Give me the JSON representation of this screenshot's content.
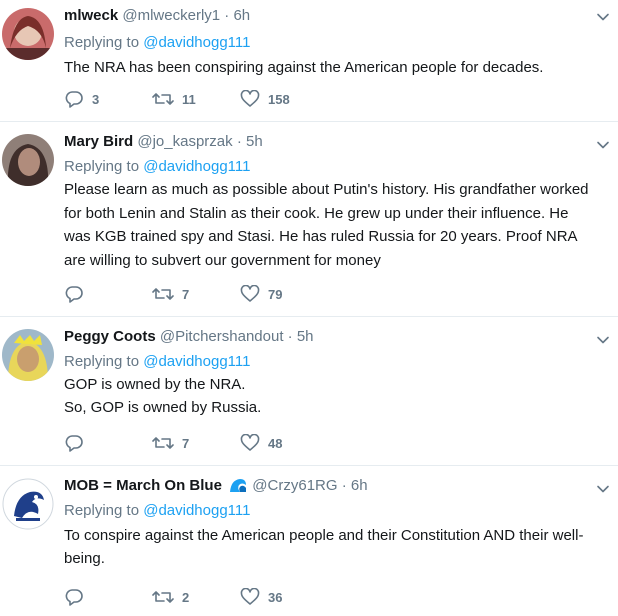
{
  "tweets": [
    {
      "name": "mlweck",
      "handle": "@mlweckerly1",
      "separator": "·",
      "time": "6h",
      "replying_prefix": "Replying to ",
      "replying_to": "@davidhogg111",
      "text": "The NRA has been conspiring against the American people for decades.",
      "replies": "3",
      "retweets": "11",
      "likes": "158",
      "avatar_colors": [
        "#7a2e2a",
        "#e7c7b5"
      ]
    },
    {
      "name": "Mary Bird",
      "handle": "@jo_kasprzak",
      "separator": "·",
      "time": "5h",
      "replying_prefix": "Replying to ",
      "replying_to": "@davidhogg111",
      "text": "Please learn as much as possible about Putin's history. His grandfather worked\nfor both Lenin and Stalin as their cook. He grew up under their influence. He\nwas KGB trained spy and Stasi. He has ruled Russia for 20 years. Proof NRA\nare willing to subvert our government for money",
      "replies": "",
      "retweets": "7",
      "likes": "79",
      "avatar_colors": [
        "#3f2e2b",
        "#b08c7c"
      ]
    },
    {
      "name": "Peggy Coots",
      "handle": "@Pitchershandout",
      "separator": "·",
      "time": "5h",
      "replying_prefix": "Replying to ",
      "replying_to": "@davidhogg111",
      "text": "GOP is owned by the NRA.\nSo, GOP is owned by Russia.",
      "replies": "",
      "retweets": "7",
      "likes": "48",
      "avatar_colors": [
        "#e8d65a",
        "#c99f6e"
      ]
    },
    {
      "name": "MOB = March On Blue",
      "handle": "@Crzy61RG",
      "separator": "·",
      "time": "6h",
      "replying_prefix": "Replying to ",
      "replying_to": "@davidhogg111",
      "text": "To conspire against the American people and their Constitution AND their well-\nbeing.",
      "replies": "",
      "retweets": "2",
      "likes": "36",
      "avatar_colors": [
        "#1f3f8a",
        "#ffffff"
      ]
    }
  ],
  "icons": {
    "reply": "reply-icon",
    "retweet": "retweet-icon",
    "like": "heart-icon",
    "more": "chevron-down-icon",
    "name_badge": "wave-icon"
  },
  "colors": {
    "link": "#1da1f2",
    "muted": "#657786",
    "divider": "#e6ecf0"
  }
}
